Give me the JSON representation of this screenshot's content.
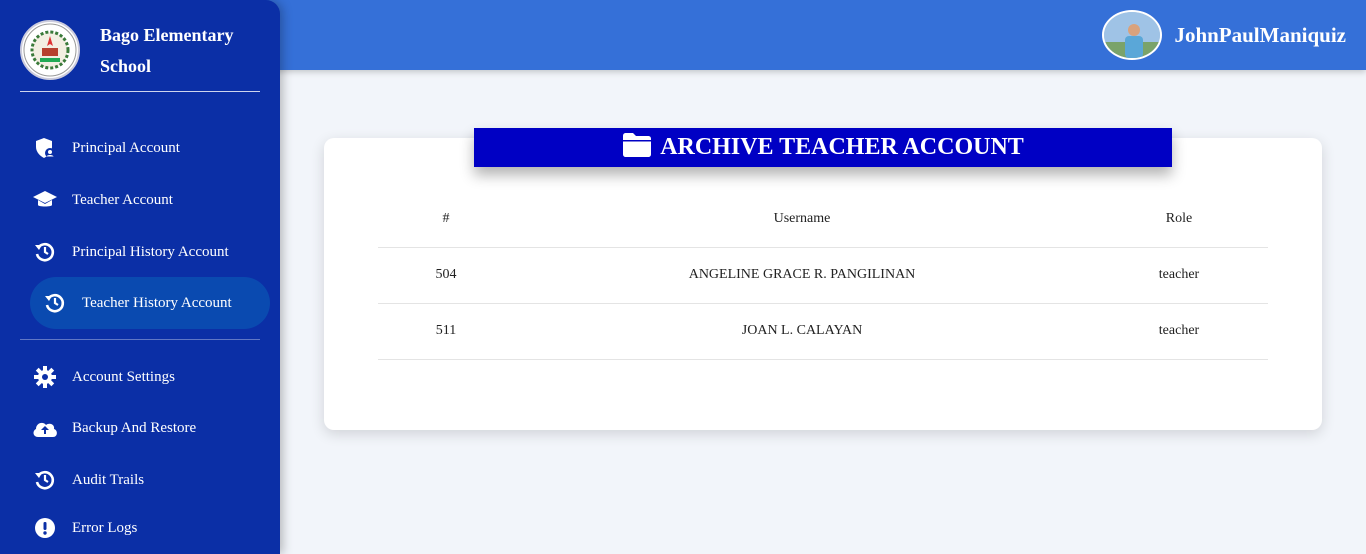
{
  "school": {
    "name": "Bago Elementary School"
  },
  "user": {
    "name": "JohnPaulManiquiz"
  },
  "sidebar": {
    "items": [
      {
        "label": "Principal Account",
        "icon": "shield-user-icon"
      },
      {
        "label": "Teacher Account",
        "icon": "graduation-cap-icon"
      },
      {
        "label": "Principal History Account",
        "icon": "history-icon"
      },
      {
        "label": "Teacher History Account",
        "icon": "history-icon",
        "active": true
      },
      {
        "label": "Account Settings",
        "icon": "gear-icon"
      },
      {
        "label": "Backup And Restore",
        "icon": "cloud-upload-icon"
      },
      {
        "label": "Audit Trails",
        "icon": "history-icon"
      },
      {
        "label": "Error Logs",
        "icon": "exclamation-circle-icon"
      }
    ]
  },
  "page": {
    "title": "ARCHIVE TEACHER ACCOUNT",
    "icon": "folder-icon"
  },
  "table": {
    "headers": [
      "#",
      "Username",
      "Role"
    ],
    "rows": [
      [
        "504",
        "ANGELINE GRACE R. PANGILINAN",
        "teacher"
      ],
      [
        "511",
        "JOAN L. CALAYAN",
        "teacher"
      ]
    ]
  },
  "colors": {
    "sidebar": "#0b2fa6",
    "topbar": "#3570d8",
    "title_bar": "#0000c4",
    "active_item": "#0a4ab0"
  }
}
